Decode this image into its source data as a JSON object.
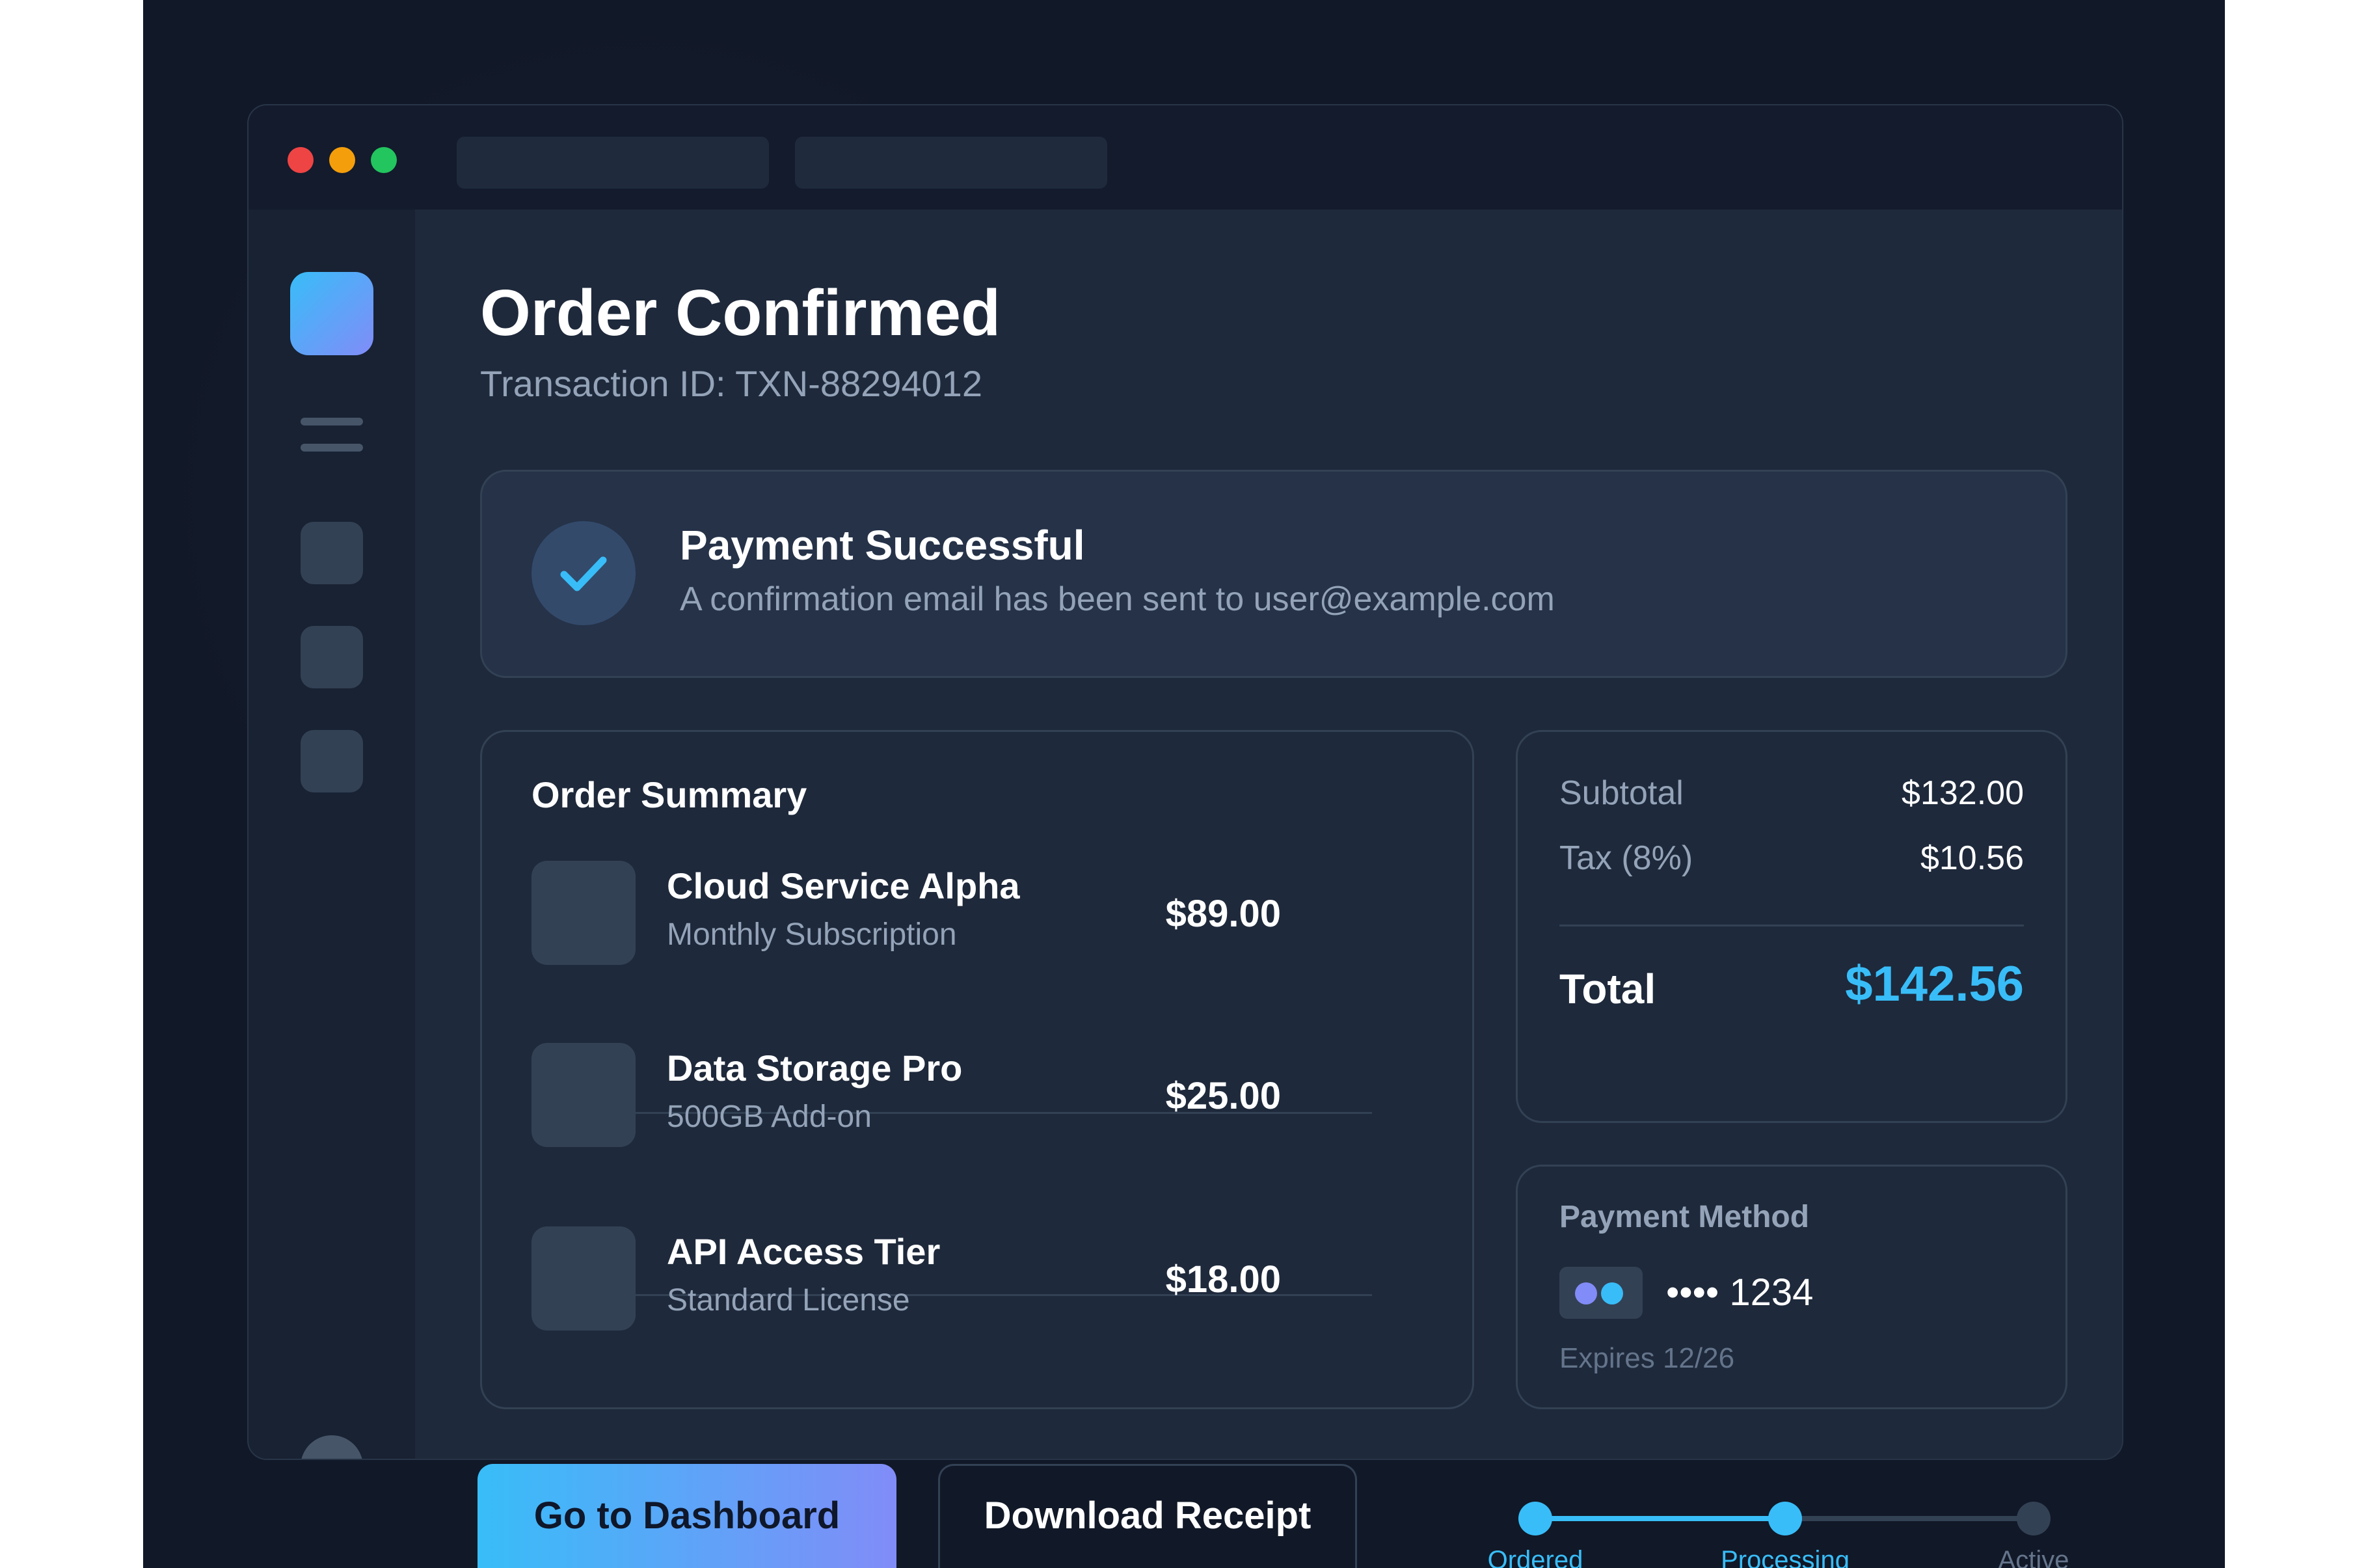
{
  "header": {
    "title": "Order Confirmed",
    "transaction": "Transaction ID: TXN-88294012"
  },
  "alert": {
    "title": "Payment Successful",
    "message": "A confirmation email has been sent to user@example.com"
  },
  "summary": {
    "title": "Order Summary",
    "items": [
      {
        "name": "Cloud Service Alpha",
        "detail": "Monthly Subscription",
        "price": "$89.00"
      },
      {
        "name": "Data Storage Pro",
        "detail": "500GB Add-on",
        "price": "$25.00"
      },
      {
        "name": "API Access Tier",
        "detail": "Standard License",
        "price": "$18.00"
      }
    ]
  },
  "totals": {
    "subtotal_label": "Subtotal",
    "subtotal": "$132.00",
    "tax_label": "Tax (8%)",
    "tax": "$10.56",
    "total_label": "Total",
    "total": "$142.56"
  },
  "payment": {
    "title": "Payment Method",
    "card_number": "•••• 1234",
    "expires": "Expires 12/26"
  },
  "actions": {
    "primary": "Go to Dashboard",
    "secondary": "Download Receipt"
  },
  "progress": {
    "steps": [
      {
        "label": "Ordered",
        "state": "complete"
      },
      {
        "label": "Processing",
        "state": "complete"
      },
      {
        "label": "Active",
        "state": "pending"
      }
    ]
  },
  "colors": {
    "accent": "#38bdf8",
    "accent_secondary": "#818cf8",
    "background": "#111827",
    "surface": "#1e293b"
  },
  "icons": [
    "window-close-dot",
    "window-minimize-dot",
    "window-maximize-dot",
    "app-logo-icon",
    "menu-icon",
    "check-icon",
    "card-brand-icon"
  ]
}
